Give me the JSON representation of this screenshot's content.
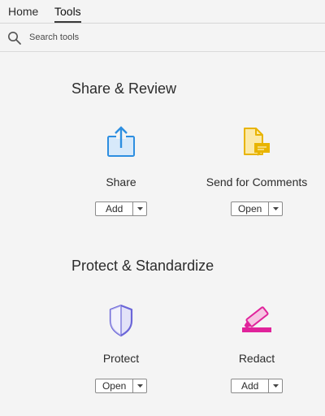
{
  "tabs": {
    "home": "Home",
    "tools": "Tools"
  },
  "search": {
    "placeholder": "Search tools",
    "icon": "search-icon"
  },
  "sections": [
    {
      "title": "Share & Review",
      "tools": [
        {
          "label": "Share",
          "icon": "share-icon",
          "button": "Add",
          "color": "#2d8ee0"
        },
        {
          "label": "Send for Comments",
          "icon": "send-for-comments-icon",
          "button": "Open",
          "color": "#e8b400"
        }
      ]
    },
    {
      "title": "Protect & Standardize",
      "tools": [
        {
          "label": "Protect",
          "icon": "shield-icon",
          "button": "Open",
          "color": "#6b66d8"
        },
        {
          "label": "Redact",
          "icon": "redact-marker-icon",
          "button": "Add",
          "color": "#e0239b"
        }
      ]
    }
  ]
}
